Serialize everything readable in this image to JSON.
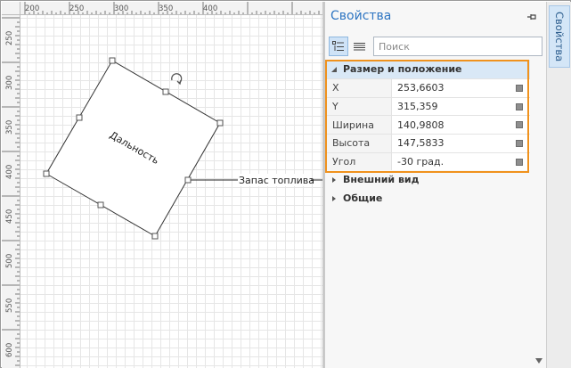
{
  "ruler": {
    "top_ticks": [
      "200",
      "250",
      "300",
      "350",
      "400"
    ],
    "left_ticks": [
      "250",
      "300",
      "350",
      "400",
      "450",
      "500",
      "550",
      "600"
    ]
  },
  "canvas": {
    "shape_label": "Дальность",
    "connector_label": "Запас топлива"
  },
  "panel": {
    "title": "Свойства",
    "search_placeholder": "Поиск",
    "categories": {
      "size": "Размер и положение",
      "appearance": "Внешний вид",
      "general": "Общие"
    },
    "properties": [
      {
        "name": "X",
        "value": "253,6603"
      },
      {
        "name": "Y",
        "value": "315,359"
      },
      {
        "name": "Ширина",
        "value": "140,9808"
      },
      {
        "name": "Высота",
        "value": "147,5833"
      },
      {
        "name": "Угол",
        "value": "-30 град."
      }
    ]
  },
  "side_tab": {
    "label": "Свойства"
  },
  "colors": {
    "accent": "#2e75c2",
    "highlight": "#f0921d",
    "selection": "#d9e8f6"
  }
}
